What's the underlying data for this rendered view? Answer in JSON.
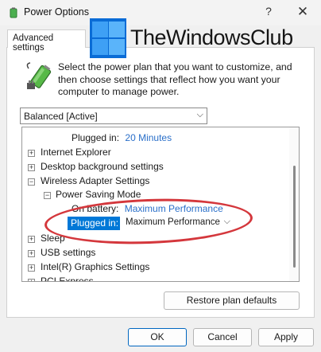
{
  "window": {
    "title": "Power Options",
    "help_glyph": "?",
    "close_glyph": "✕"
  },
  "tab": {
    "label": "Advanced settings"
  },
  "logo": {
    "text": "TheWindowsClub"
  },
  "description": "Select the power plan that you want to customize, and then choose settings that reflect how you want your computer to manage power.",
  "plan_select": {
    "value": "Balanced [Active]",
    "chevron": "⌵"
  },
  "tree": {
    "plugged_in_top": {
      "label": "Plugged in:",
      "value": "20 Minutes"
    },
    "items": {
      "internet_explorer": "Internet Explorer",
      "desktop_background": "Desktop background settings",
      "wireless_adapter": "Wireless Adapter Settings",
      "power_saving_mode": "Power Saving Mode",
      "sleep": "Sleep",
      "usb": "USB settings",
      "intel_graphics": "Intel(R) Graphics Settings",
      "pci_express": "PCI Express"
    },
    "on_battery": {
      "label": "On battery:",
      "value": "Maximum Performance"
    },
    "plugged_in": {
      "label": "Plugged in:",
      "value": "Maximum Performance",
      "chevron": "⌵"
    },
    "expand_plus": "+",
    "expand_minus": "−"
  },
  "buttons": {
    "restore": "Restore plan defaults",
    "ok": "OK",
    "cancel": "Cancel",
    "apply": "Apply"
  },
  "colors": {
    "accent": "#0078d7",
    "link": "#2a6fc9",
    "annotation": "#d4373c",
    "logo_bg": "#0a6cd6"
  }
}
